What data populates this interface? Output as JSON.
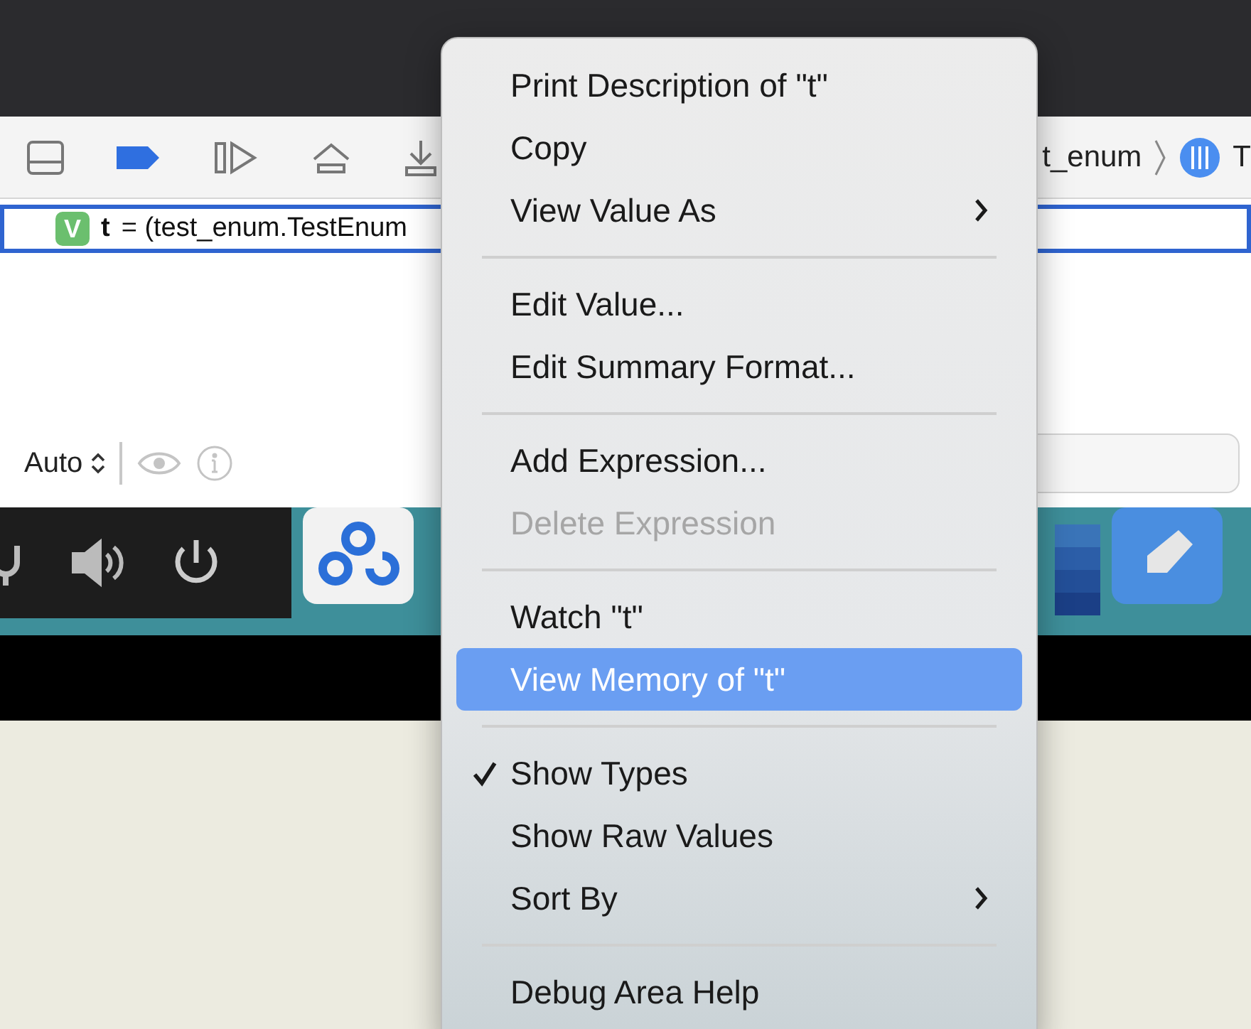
{
  "toolbar": {
    "breadcrumb": [
      {
        "label": "t_enum"
      },
      {
        "label": "T"
      }
    ]
  },
  "variables": [
    {
      "badge": "V",
      "name": "t",
      "value": "= (test_enum.TestEnum",
      "selected": true
    }
  ],
  "filter_bar": {
    "scope": "Auto"
  },
  "context_menu": {
    "items": [
      {
        "kind": "item",
        "label": "Print Description of \"t\"",
        "disabled": false,
        "selected": false,
        "checked": false,
        "submenu": false
      },
      {
        "kind": "item",
        "label": "Copy",
        "disabled": false,
        "selected": false,
        "checked": false,
        "submenu": false
      },
      {
        "kind": "item",
        "label": "View Value As",
        "disabled": false,
        "selected": false,
        "checked": false,
        "submenu": true
      },
      {
        "kind": "separator"
      },
      {
        "kind": "item",
        "label": "Edit Value...",
        "disabled": false,
        "selected": false,
        "checked": false,
        "submenu": false
      },
      {
        "kind": "item",
        "label": "Edit Summary Format...",
        "disabled": false,
        "selected": false,
        "checked": false,
        "submenu": false
      },
      {
        "kind": "separator"
      },
      {
        "kind": "item",
        "label": "Add Expression...",
        "disabled": false,
        "selected": false,
        "checked": false,
        "submenu": false
      },
      {
        "kind": "item",
        "label": "Delete Expression",
        "disabled": true,
        "selected": false,
        "checked": false,
        "submenu": false
      },
      {
        "kind": "separator"
      },
      {
        "kind": "item",
        "label": "Watch \"t\"",
        "disabled": false,
        "selected": false,
        "checked": false,
        "submenu": false
      },
      {
        "kind": "item",
        "label": "View Memory of \"t\"",
        "disabled": false,
        "selected": true,
        "checked": false,
        "submenu": false
      },
      {
        "kind": "separator"
      },
      {
        "kind": "item",
        "label": "Show Types",
        "disabled": false,
        "selected": false,
        "checked": true,
        "submenu": false
      },
      {
        "kind": "item",
        "label": "Show Raw Values",
        "disabled": false,
        "selected": false,
        "checked": false,
        "submenu": false
      },
      {
        "kind": "item",
        "label": "Sort By",
        "disabled": false,
        "selected": false,
        "checked": false,
        "submenu": true
      },
      {
        "kind": "separator"
      },
      {
        "kind": "item",
        "label": "Debug Area Help",
        "disabled": false,
        "selected": false,
        "checked": false,
        "submenu": false
      }
    ]
  }
}
